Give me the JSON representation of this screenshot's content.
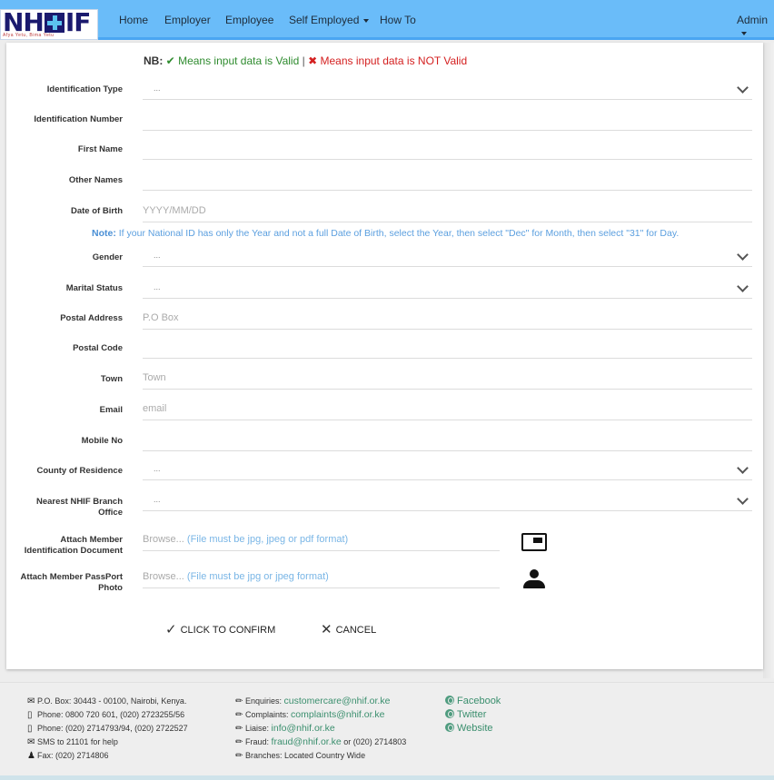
{
  "brand": {
    "logo_text_left": "NH",
    "logo_text_right": "IF",
    "tagline": "Afya Yetu, Bima Yetu"
  },
  "nav": {
    "items": [
      {
        "label": "Home"
      },
      {
        "label": "Employer"
      },
      {
        "label": "Employee"
      },
      {
        "label": "Self Employed",
        "dropdown": true
      },
      {
        "label": "How To"
      }
    ],
    "user": {
      "label": "Admin",
      "dropdown": true
    }
  },
  "legend": {
    "prefix": "NB:",
    "valid_icon": "check-icon",
    "valid_text": "Means input data is Valid",
    "separator": "|",
    "invalid_icon": "cross-icon",
    "invalid_text": "Means input data is NOT Valid",
    "valid_color": "#2e8b2e",
    "invalid_color": "#d42020"
  },
  "form": {
    "identification_type": {
      "label": "Identification Type",
      "value": "..."
    },
    "identification_number": {
      "label": "Identification Number",
      "value": ""
    },
    "first_name": {
      "label": "First Name",
      "value": ""
    },
    "other_names": {
      "label": "Other Names",
      "value": ""
    },
    "date_of_birth": {
      "label": "Date of Birth",
      "placeholder": "YYYY/MM/DD"
    },
    "dob_note": {
      "prefix": "Note:",
      "text": "If your National ID has only the Year and not a full Date of Birth, select the Year, then select \"Dec\" for Month, then select \"31\" for Day."
    },
    "gender": {
      "label": "Gender",
      "value": "..."
    },
    "marital_status": {
      "label": "Marital Status",
      "value": "..."
    },
    "postal_address": {
      "label": "Postal Address",
      "placeholder": "P.O Box"
    },
    "postal_code": {
      "label": "Postal Code",
      "value": ""
    },
    "town": {
      "label": "Town",
      "placeholder": "Town"
    },
    "email": {
      "label": "Email",
      "placeholder": "email"
    },
    "mobile_no": {
      "label": "Mobile No",
      "value": ""
    },
    "county": {
      "label": "County of Residence",
      "value": "..."
    },
    "branch": {
      "label_line1": "Nearest NHIF Branch",
      "label_line2": "Office",
      "value": "..."
    },
    "id_document": {
      "label_line1": "Attach Member",
      "label_line2": "Identification Document",
      "browse": "Browse...",
      "hint": "(File must be jpg, jpeg or pdf format)"
    },
    "passport_photo": {
      "label_line1": "Attach Member PassPort",
      "label_line2": "Photo",
      "browse": "Browse...",
      "hint": "(File must be jpg or jpeg format)"
    }
  },
  "actions": {
    "confirm_label": "CLICK TO CONFIRM",
    "cancel_label": "CANCEL"
  },
  "footer": {
    "contact": [
      {
        "icon": "envelope-icon",
        "text": "P.O. Box: 30443 - 00100, Nairobi, Kenya."
      },
      {
        "icon": "phone-icon",
        "text": "Phone: 0800 720 601, (020) 2723255/56"
      },
      {
        "icon": "phone-icon",
        "text": "Phone: (020) 2714793/94, (020) 2722527"
      },
      {
        "icon": "envelope-icon",
        "text": "SMS to 21101 for help"
      },
      {
        "icon": "user-icon",
        "text": "Fax: (020) 2714806"
      }
    ],
    "emails": [
      {
        "prefix": "Enquiries:",
        "link": "customercare@nhif.or.ke",
        "suffix": ""
      },
      {
        "prefix": "Complaints:",
        "link": "complaints@nhif.or.ke",
        "suffix": ""
      },
      {
        "prefix": "Liaise:",
        "link": "info@nhif.or.ke",
        "suffix": ""
      },
      {
        "prefix": "Fraud:",
        "link": "fraud@nhif.or.ke",
        "suffix": "or (020) 2714803"
      },
      {
        "prefix": "Branches: Located Country Wide",
        "link": "",
        "suffix": ""
      }
    ],
    "social": [
      {
        "label": "Facebook"
      },
      {
        "label": "Twitter"
      },
      {
        "label": "Website"
      }
    ]
  }
}
